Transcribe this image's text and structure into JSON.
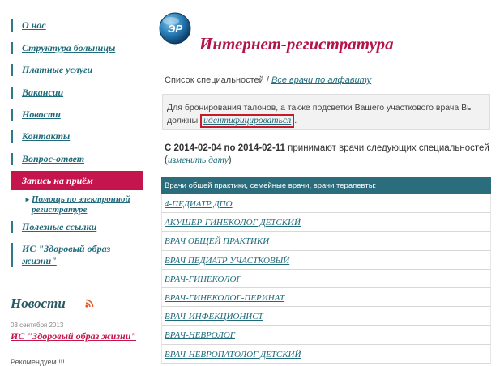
{
  "sidebar": {
    "items": [
      {
        "label": "О нас"
      },
      {
        "label": "Структура больницы"
      },
      {
        "label": "Платные услуги"
      },
      {
        "label": "Вакансии"
      },
      {
        "label": "Новости"
      },
      {
        "label": "Контакты"
      },
      {
        "label": "Вопрос-ответ"
      },
      {
        "label": "Запись на приём"
      },
      {
        "label": "Полезные ссылки"
      },
      {
        "label": "ИС \"Здоровый образ жизни\""
      }
    ],
    "subitem": {
      "label": "Помощь по электронной регистратуре"
    },
    "news": {
      "heading": "Новости",
      "date": "03 сентября 2013",
      "title": "ИС \"Здоровый образ жизни\"",
      "snippet": "Рекомендуем !!!"
    }
  },
  "header": {
    "logo_text": "ЭР",
    "title": "Интернет-регистратура"
  },
  "breadcrumb": {
    "current": "Список специальностей",
    "separator": "/",
    "link": "Все врачи по алфавиту"
  },
  "notice": {
    "text": "Для бронирования талонов, а также подсветки Вашего участкового врача Вы должны",
    "link": "идентифицироваться",
    "end": "."
  },
  "dates": {
    "prefix": "С",
    "from": "2014-02-04",
    "mid": "по",
    "to": "2014-02-11",
    "text": "принимают врачи следующих специальностей",
    "link": "изменить дату"
  },
  "table": {
    "header": "Врачи общей практики, семейные врачи, врачи терапевты:",
    "rows": [
      "4-ПЕДИАТР ДПО",
      "АКУШЕР-ГИНЕКОЛОГ ДЕТСКИЙ",
      "ВРАЧ ОБЩЕЙ ПРАКТИКИ",
      "ВРАЧ ПЕДИАТР УЧАСТКОВЫЙ",
      "ВРАЧ-ГИНЕКОЛОГ",
      "ВРАЧ-ГИНЕКОЛОГ-ПЕРИНАТ",
      "ВРАЧ-ИНФЕКЦИОНИСТ",
      "ВРАЧ-НЕВРОЛОГ",
      "ВРАЧ-НЕВРОПАТОЛОГ ДЕТСКИЙ"
    ]
  },
  "colors": {
    "accent": "#c5154d",
    "link": "#1f6b7b",
    "table_header": "#2b6d7c",
    "highlight_box": "#c81a2a"
  },
  "icons": {
    "logo": "er-logo-icon",
    "rss": "rss-icon",
    "bullet": "bullet-icon"
  }
}
